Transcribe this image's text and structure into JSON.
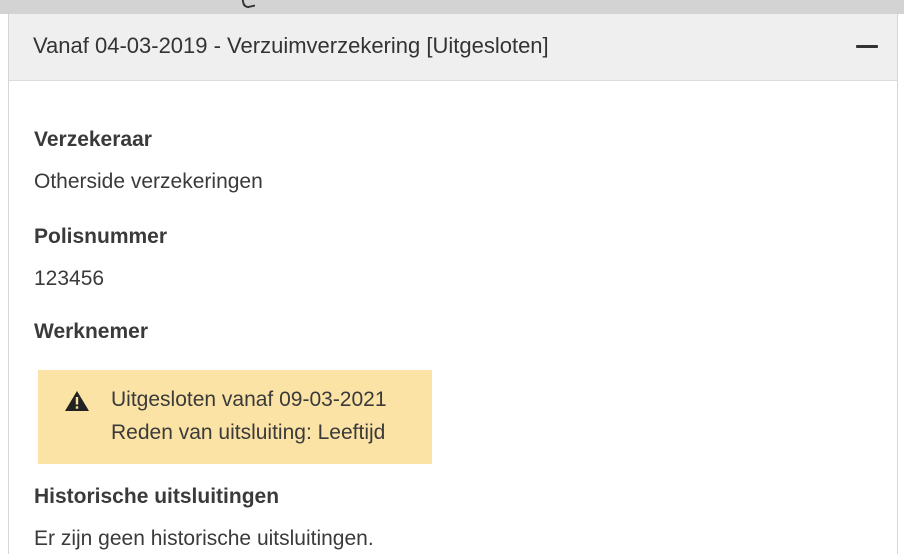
{
  "panel": {
    "title": "Vanaf 04-03-2019 - Verzuimverzekering [Uitgesloten]",
    "collapse_icon": "minus-icon"
  },
  "fields": {
    "insurer_label": "Verzekeraar",
    "insurer_value": "Otherside verzekeringen",
    "policy_label": "Polisnummer",
    "policy_value": "123456",
    "employee_label": "Werknemer",
    "history_label": "Historische uitsluitingen",
    "history_value": "Er zijn geen historische uitsluitingen."
  },
  "warning": {
    "icon": "warning-triangle-icon",
    "line1": "Uitgesloten vanaf 09-03-2021",
    "line2": "Reden van uitsluiting: Leeftijd",
    "background_color": "#fbe3a6"
  },
  "colors": {
    "header_bg": "#efefef",
    "text": "#333333"
  }
}
